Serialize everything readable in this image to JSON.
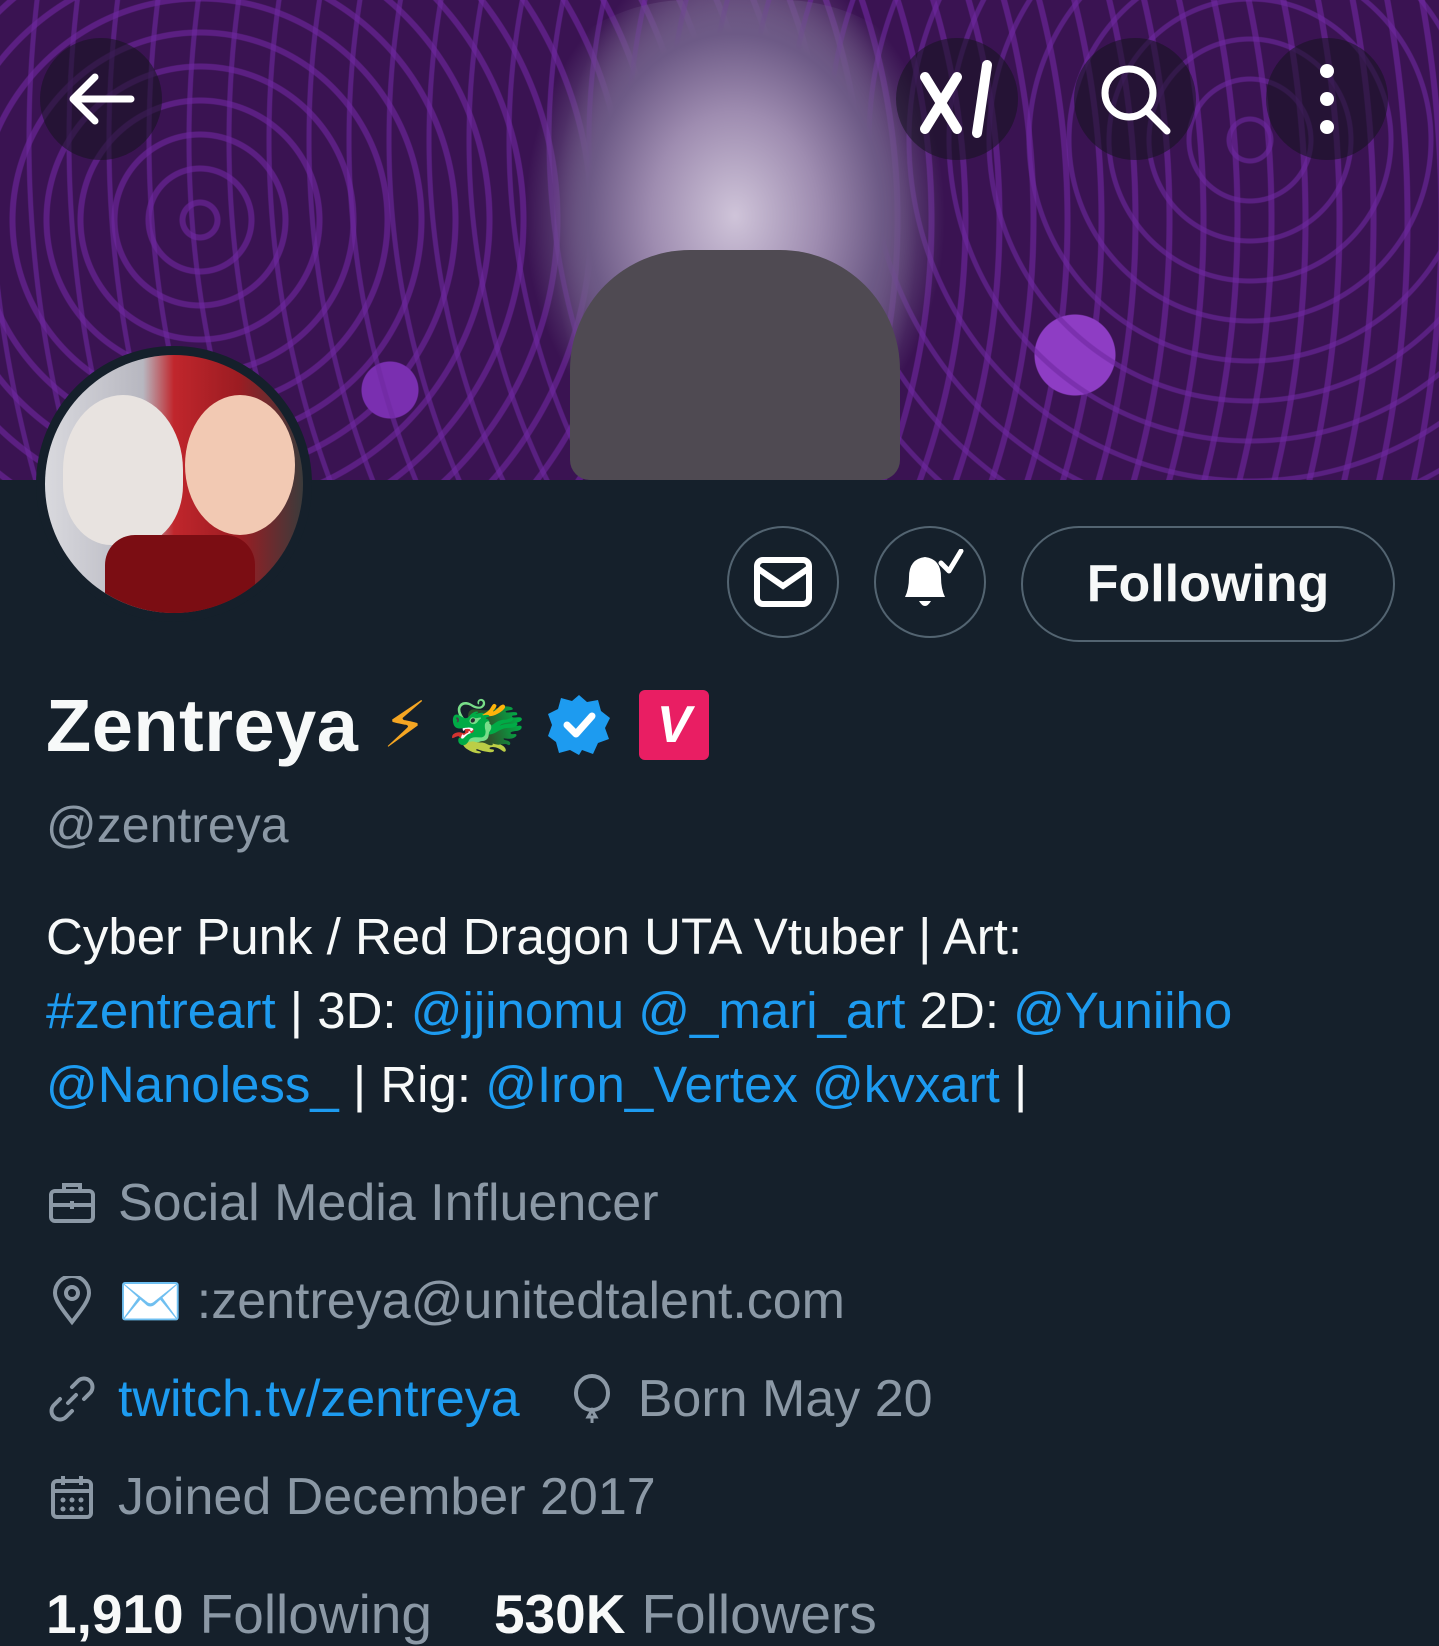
{
  "header": {
    "back_icon": "arrow-left-icon",
    "grok_icon": "grok-icon",
    "search_icon": "search-icon",
    "more_icon": "more-vertical-icon"
  },
  "actions": {
    "message_icon": "envelope-icon",
    "notify_icon": "bell-check-icon",
    "following_label": "Following"
  },
  "profile": {
    "name": "Zentreya",
    "name_emojis": [
      "⚡",
      "🐲"
    ],
    "verified_badge": "verified-badge-icon",
    "affiliate_badge": "V",
    "handle": "@zentreya"
  },
  "bio": {
    "line1": "Cyber Punk / Red Dragon  UTA Vtuber | Art:",
    "hashtag": "#zentreart",
    "sep1": " | 3D: ",
    "m1": "@jjinomu",
    "m2": "@_mari_art",
    "t2d": " 2D: ",
    "m3": "@Yuniiho",
    "m4": "@Nanoless_",
    "sep2": " | Rig: ",
    "m5": "@Iron_Vertex",
    "m6": "@kvxart",
    "end": " |"
  },
  "meta": {
    "category": "Social Media Influencer",
    "location_emoji": "✉️",
    "location": ":zentreya@unitedtalent.com",
    "website": "twitch.tv/zentreya",
    "birthday": "Born May 20",
    "joined": "Joined December 2017"
  },
  "stats": {
    "following_count": "1,910",
    "following_label": "Following",
    "followers_count": "530K",
    "followers_label": "Followers"
  },
  "colors": {
    "background": "#15202b",
    "link": "#1d9bf0",
    "muted": "#8b98a5",
    "border": "#536471",
    "verified": "#1d9bf0",
    "affiliate": "#e91e63"
  }
}
